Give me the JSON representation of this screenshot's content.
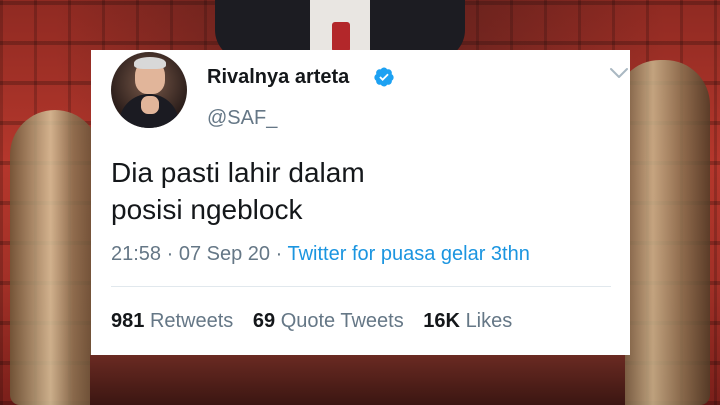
{
  "tweet": {
    "display_name": "Rivalnya arteta",
    "handle": "@SAF_",
    "text_line1": "Dia pasti lahir dalam",
    "text_line2": "posisi ngeblock",
    "time": "21:58",
    "date": "07 Sep 20",
    "separator": "·",
    "source": "Twitter for puasa gelar 3thn",
    "stats": {
      "retweets_count": "981",
      "retweets_label": "Retweets",
      "quotes_count": "69",
      "quotes_label": "Quote Tweets",
      "likes_count": "16K",
      "likes_label": "Likes"
    }
  },
  "icons": {
    "verified": "verified-badge-icon",
    "menu": "chevron-down-icon"
  },
  "colors": {
    "link_blue": "#1b95e0",
    "muted_gray": "#657786",
    "text_dark": "#14171a",
    "background_red": "#b5372c"
  }
}
